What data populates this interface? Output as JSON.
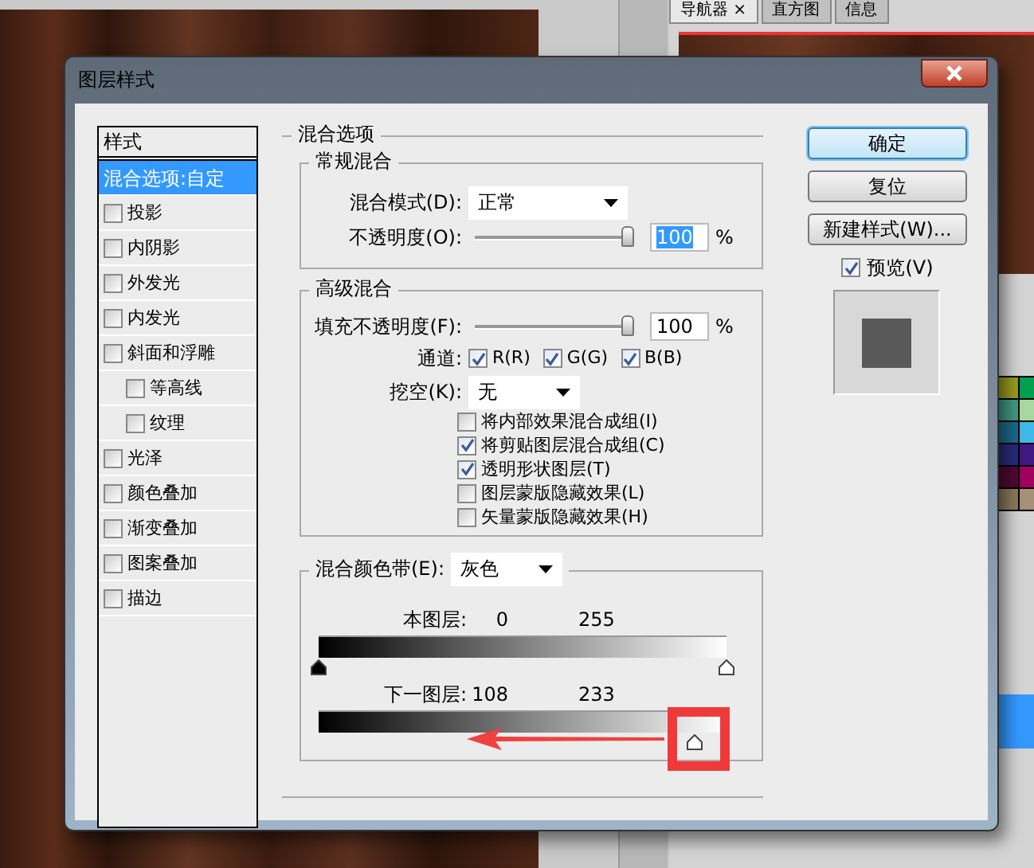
{
  "panel_tabs": [
    {
      "label": "导航器 ×",
      "selected": true
    },
    {
      "label": "直方图",
      "selected": false
    },
    {
      "label": "信息",
      "selected": false
    }
  ],
  "swatches": [
    {
      "color": "#9a9a1e"
    },
    {
      "color": "#00a050"
    },
    {
      "color": "#3f9a80"
    },
    {
      "color": "#a8d8a0"
    },
    {
      "color": "#1a6a8a"
    },
    {
      "color": "#40b8e8"
    },
    {
      "color": "#2a2a7a"
    },
    {
      "color": "#401880"
    },
    {
      "color": "#500830"
    },
    {
      "color": "#a00060"
    },
    {
      "color": "#8a7a5a"
    },
    {
      "color": "#a89078"
    }
  ],
  "dialog": {
    "title": "图层样式"
  },
  "styles": {
    "header": "样式",
    "items": [
      {
        "label": "混合选项:自定",
        "kind": "plain",
        "selected": true
      },
      {
        "label": "投影",
        "kind": "effect",
        "selected": false,
        "checked": false
      },
      {
        "label": "内阴影",
        "kind": "effect",
        "selected": false,
        "checked": false
      },
      {
        "label": "外发光",
        "kind": "effect",
        "selected": false,
        "checked": false
      },
      {
        "label": "内发光",
        "kind": "effect",
        "selected": false,
        "checked": false
      },
      {
        "label": "斜面和浮雕",
        "kind": "effect",
        "selected": false,
        "checked": false
      },
      {
        "label": "等高线",
        "kind": "sub",
        "selected": false,
        "checked": false
      },
      {
        "label": "纹理",
        "kind": "sub",
        "selected": false,
        "checked": false
      },
      {
        "label": "光泽",
        "kind": "effect",
        "selected": false,
        "checked": false
      },
      {
        "label": "颜色叠加",
        "kind": "effect",
        "selected": false,
        "checked": false
      },
      {
        "label": "渐变叠加",
        "kind": "effect",
        "selected": false,
        "checked": false
      },
      {
        "label": "图案叠加",
        "kind": "effect",
        "selected": false,
        "checked": false
      },
      {
        "label": "描边",
        "kind": "effect",
        "selected": false,
        "checked": false
      }
    ]
  },
  "blend_options": {
    "title": "混合选项",
    "general": {
      "title": "常规混合",
      "mode_label": "混合模式(D):",
      "mode_value": "正常",
      "opacity_label": "不透明度(O):",
      "opacity": {
        "level": 1,
        "value": "100",
        "highlighted": true
      },
      "unit": "%"
    },
    "advanced": {
      "title": "高级混合",
      "fill_label": "填充不透明度(F):",
      "fill": {
        "level": 1,
        "value": "100",
        "highlighted": false
      },
      "unit": "%",
      "channels_label": "通道:",
      "channels": [
        {
          "label": "R(R)",
          "checked": true
        },
        {
          "label": "G(G)",
          "checked": true
        },
        {
          "label": "B(B)",
          "checked": true
        }
      ],
      "knockout_label": "挖空(K):",
      "knockout_value": "无",
      "options": [
        {
          "label": "将内部效果混合成组(I)",
          "checked": false
        },
        {
          "label": "将剪贴图层混合成组(C)",
          "checked": true
        },
        {
          "label": "透明形状图层(T)",
          "checked": true
        },
        {
          "label": "图层蒙版隐藏效果(L)",
          "checked": false
        },
        {
          "label": "矢量蒙版隐藏效果(H)",
          "checked": false
        }
      ]
    },
    "blend_if": {
      "label": "混合颜色带(E):",
      "value": "灰色",
      "bands": [
        {
          "label": "本图层:",
          "low": "0",
          "high": "255",
          "thumbs": [
            {
              "level": 0,
              "kind": "black"
            },
            {
              "level": 1,
              "kind": "white"
            }
          ]
        },
        {
          "label": "下一图层:",
          "low": "108",
          "high": "233",
          "thumbs": [
            {
              "level": 0.92,
              "kind": "white"
            }
          ]
        }
      ]
    }
  },
  "buttons": [
    {
      "label": "确定",
      "default": true
    },
    {
      "label": "复位",
      "default": false
    },
    {
      "label": "新建样式(W)...",
      "default": false
    }
  ],
  "preview": {
    "label": "预览(V)",
    "checked": true
  }
}
